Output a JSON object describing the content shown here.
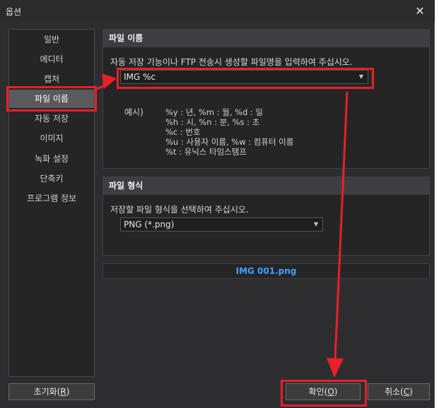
{
  "window": {
    "title": "옵션"
  },
  "sidebar": {
    "items": [
      {
        "label": "일반"
      },
      {
        "label": "에디터"
      },
      {
        "label": "캡처"
      },
      {
        "label": "파일 이름"
      },
      {
        "label": "자동 저장"
      },
      {
        "label": "이미지"
      },
      {
        "label": "녹화 설정"
      },
      {
        "label": "단축키"
      },
      {
        "label": "프로그램 정보"
      }
    ],
    "selected_index": 3
  },
  "filename_section": {
    "header": "파일 이름",
    "description": "자동 저장 기능이나 FTP 전송시 생성할 파일명을 입력하여 주십시오.",
    "pattern_value": "IMG %c",
    "example_label": "예시)",
    "examples": [
      "%y : 년, %m : 월, %d : 일",
      "%h : 시, %n : 분, %s : 초",
      "%c : 번호",
      "%u : 사용자 이름, %w : 컴퓨터 이름",
      "%t : 유닉스 타임스탬프"
    ]
  },
  "format_section": {
    "header": "파일 형식",
    "description": "저장할 파일 형식을 선택하여 주십시오.",
    "selected_format": "PNG (*.png)"
  },
  "preview": {
    "filename": "IMG 001.png"
  },
  "buttons": {
    "reset_label": "초기화",
    "reset_key": "R",
    "ok_label": "확인",
    "ok_key": "O",
    "cancel_label": "취소",
    "cancel_key": "C"
  },
  "colors": {
    "background": "#2d2d30",
    "highlight": "#e8202a",
    "preview_text": "#3ea2ff",
    "selected_item": "#5a5a5e"
  },
  "icons": {
    "close": "close-icon",
    "dropdown": "chevron-down-icon"
  }
}
